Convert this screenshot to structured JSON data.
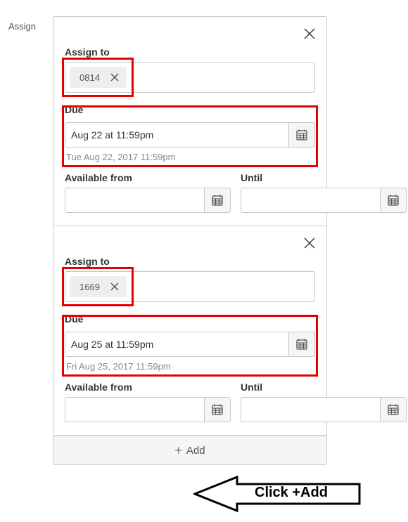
{
  "pageLabel": "Assign",
  "blocks": [
    {
      "assignToLabel": "Assign to",
      "pill": "0814",
      "dueLabel": "Due",
      "dueValue": "Aug 22 at 11:59pm",
      "dueCaption": "Tue Aug 22, 2017 11:59pm",
      "availableFromLabel": "Available from",
      "untilLabel": "Until",
      "availableFromValue": "",
      "untilValue": ""
    },
    {
      "assignToLabel": "Assign to",
      "pill": "1669",
      "dueLabel": "Due",
      "dueValue": "Aug 25 at 11:59pm",
      "dueCaption": "Fri Aug 25, 2017 11:59pm",
      "availableFromLabel": "Available from",
      "untilLabel": "Until",
      "availableFromValue": "",
      "untilValue": ""
    }
  ],
  "addLabel": "Add",
  "callout": "Click +Add",
  "colors": {
    "highlight": "#e60000",
    "panelBorder": "#cccccc",
    "addBg": "#f5f5f5"
  }
}
